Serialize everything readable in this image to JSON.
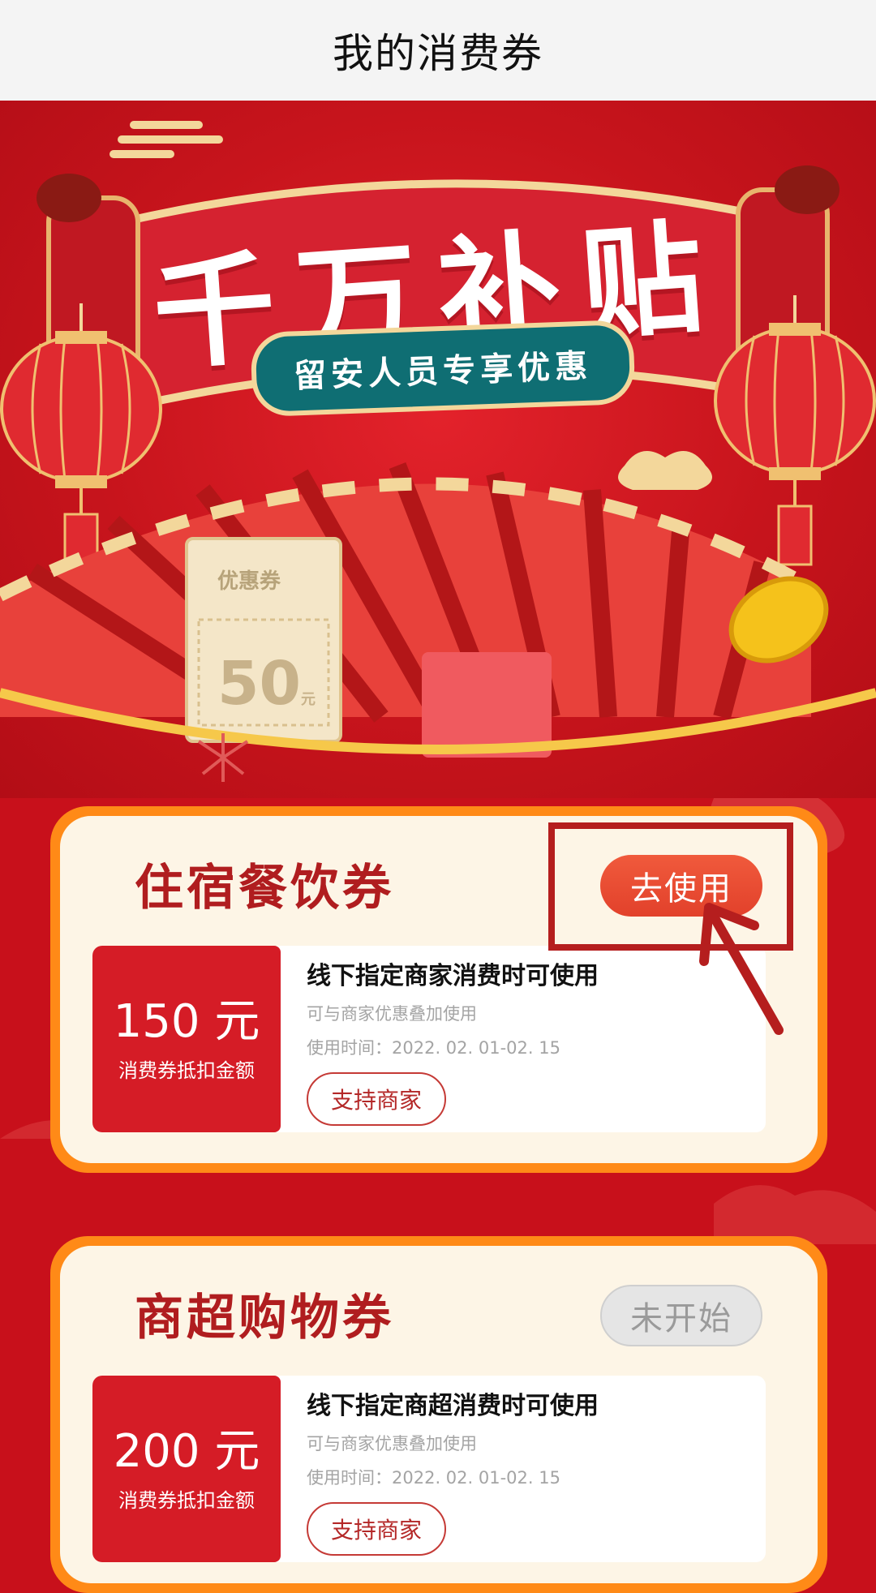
{
  "header": {
    "title": "我的消费券"
  },
  "hero": {
    "title": "千万补贴",
    "subtitle": "留安人员专享优惠",
    "ticket_label": "优惠券",
    "ticket_value": "50",
    "ticket_unit": "元"
  },
  "colors": {
    "brand_red": "#c8101b",
    "card_border": "#ff8a17",
    "card_bg": "#fdf5e6",
    "teal": "#0f6e73",
    "gold": "#f3d79b"
  },
  "coupons": [
    {
      "title": "住宿餐饮券",
      "button": "去使用",
      "button_state": "active",
      "amount": "150 元",
      "amount_label": "消费券抵扣金额",
      "description": "线下指定商家消费时可使用",
      "sub": "可与商家优惠叠加使用",
      "time": "使用时间：2022. 02. 01-02. 15",
      "merchant_button": "支持商家"
    },
    {
      "title": "商超购物券",
      "button": "未开始",
      "button_state": "inactive",
      "amount": "200 元",
      "amount_label": "消费券抵扣金额",
      "description": "线下指定商超消费时可使用",
      "sub": "可与商家优惠叠加使用",
      "time": "使用时间：2022. 02. 01-02. 15",
      "merchant_button": "支持商家"
    }
  ]
}
